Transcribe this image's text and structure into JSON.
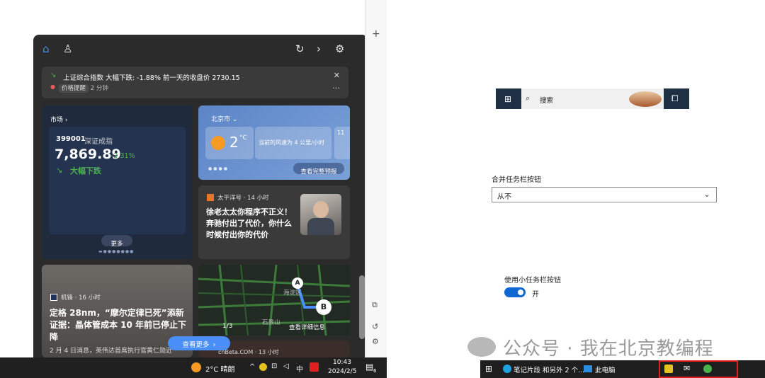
{
  "widgets": {
    "notification": {
      "title": "上证综合指数 大幅下跌: -1.88% 前一天的收盘价 2730.15",
      "tag": "价格提醒",
      "time": "2 分钟"
    },
    "market": {
      "header": "市场",
      "code": "399001",
      "name": "深证成指",
      "value": "7,869.89",
      "change": "-2.31%",
      "status": "大幅下跌",
      "more": "更多"
    },
    "weather": {
      "city": "北京市",
      "temp": "2",
      "unit": "°C",
      "desc": "当前的风速为 4 公里/小时",
      "next_temp": "11",
      "link": "查看完整预报"
    },
    "news1": {
      "source": "太平洋号",
      "time": "14 小时",
      "headline": "徐老太太你程序不正义！奔驰付出了代价，你什么时候付出你的代价"
    },
    "news2": {
      "source": "机锋",
      "time": "16 小时",
      "headline": "定格 28nm，“摩尔定律已死”添新证据：晶体管成本 10 年前已停止下降",
      "summary": "2 月 4 日消息，英伟达首席执行官黄仁勋近"
    },
    "map": {
      "pager": "1/3",
      "detail": "查看详细信息",
      "label_a": "A",
      "label_b": "B",
      "place1": "海淀区",
      "place2": "石景山"
    },
    "news3": {
      "source": "cnBeta.COM",
      "time": "13 小时"
    },
    "see_more": "查看更多"
  },
  "taskbar_left": {
    "weather": "2°C 晴朗",
    "ime": "中",
    "time": "10:43",
    "date": "2024/2/5",
    "notif_count": "6"
  },
  "right": {
    "search_placeholder": "搜索",
    "combine_label": "合并任务栏按钮",
    "combine_value": "从不",
    "small_label": "使用小任务栏按钮",
    "small_value": "开",
    "watermark": "公众号 · 我在北京教编程",
    "taskbar_app1": "笔记片段 和另外 2 个...",
    "taskbar_app2": "此电脑"
  }
}
